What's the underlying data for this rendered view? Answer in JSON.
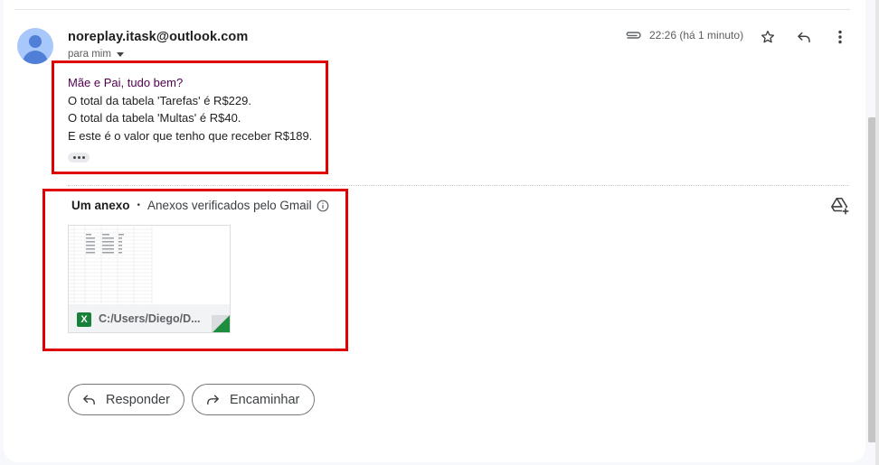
{
  "email": {
    "sender": "noreplay.itask@outlook.com",
    "recipient": "para mim",
    "time": "22:26 (há 1 minuto)"
  },
  "body": {
    "lines": [
      "Mãe e Pai, tudo bem?",
      "O total da tabela 'Tarefas' é R$229.",
      "O total da tabela 'Multas' é R$40.",
      "E este é o valor que tenho que receber R$189."
    ]
  },
  "attachments": {
    "count_label": "Um anexo",
    "scan_label": "Anexos verificados pelo Gmail",
    "file_name": "C:/Users/Diego/D...",
    "file_type_letter": "X"
  },
  "actions": {
    "reply": "Responder",
    "forward": "Encaminhar"
  },
  "colors": {
    "highlight_border": "#e00000",
    "excel_green": "#188038",
    "greeting_text": "#500050",
    "avatar_bg": "#a8c7fa"
  },
  "icons": [
    "person-avatar-icon",
    "chevron-down-icon",
    "paperclip-icon",
    "star-icon",
    "reply-icon",
    "more-vert-icon",
    "info-icon",
    "add-to-drive-icon",
    "excel-icon",
    "forward-icon"
  ]
}
